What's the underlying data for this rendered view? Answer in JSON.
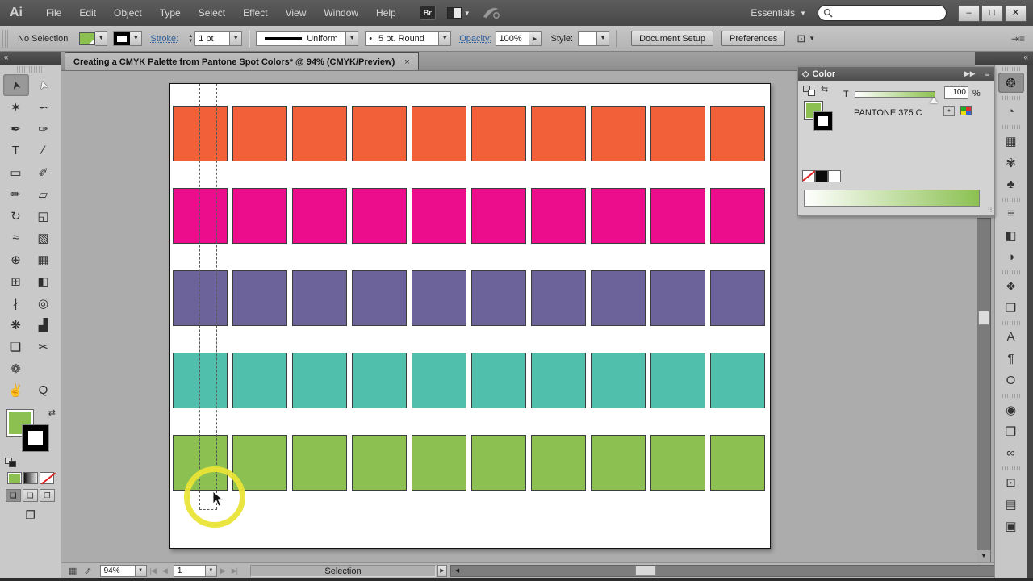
{
  "titlebar": {
    "logo": "Ai",
    "menus": [
      "File",
      "Edit",
      "Object",
      "Type",
      "Select",
      "Effect",
      "View",
      "Window",
      "Help"
    ],
    "bridge_label": "Br",
    "workspace": "Essentials",
    "search_placeholder": "",
    "window_buttons": {
      "minimize": "–",
      "maximize": "□",
      "close": "✕"
    }
  },
  "controlbar": {
    "selection_status": "No Selection",
    "stroke_label": "Stroke:",
    "stroke_value": "1 pt",
    "profile_value": "Uniform",
    "brush_bullet": "•",
    "brush_value": "5 pt. Round",
    "opacity_label": "Opacity:",
    "opacity_value": "100%",
    "style_label": "Style:",
    "document_setup_label": "Document Setup",
    "preferences_label": "Preferences"
  },
  "tab": {
    "title": "Creating a CMYK Palette from Pantone Spot Colors* @ 94% (CMYK/Preview)",
    "close": "×"
  },
  "toolbar": {
    "collapse": "«",
    "tools": [
      {
        "name": "selection",
        "glyph": "➤",
        "selected": true
      },
      {
        "name": "direct-selection",
        "glyph": "➤"
      },
      {
        "name": "magic-wand",
        "glyph": "✶"
      },
      {
        "name": "lasso",
        "glyph": "∽"
      },
      {
        "name": "pen",
        "glyph": "✒"
      },
      {
        "name": "blob-brush",
        "glyph": "✑"
      },
      {
        "name": "type",
        "glyph": "T"
      },
      {
        "name": "line-segment",
        "glyph": "∕"
      },
      {
        "name": "rectangle",
        "glyph": "▭"
      },
      {
        "name": "paintbrush",
        "glyph": "✐"
      },
      {
        "name": "pencil",
        "glyph": "✏"
      },
      {
        "name": "eraser",
        "glyph": "▱"
      },
      {
        "name": "rotate",
        "glyph": "↻"
      },
      {
        "name": "scale",
        "glyph": "◱"
      },
      {
        "name": "width",
        "glyph": "≈"
      },
      {
        "name": "free-transform",
        "glyph": "▧"
      },
      {
        "name": "shape-builder",
        "glyph": "⊕"
      },
      {
        "name": "perspective-grid",
        "glyph": "▦"
      },
      {
        "name": "mesh",
        "glyph": "⊞"
      },
      {
        "name": "gradient",
        "glyph": "◧"
      },
      {
        "name": "eyedropper",
        "glyph": "∤"
      },
      {
        "name": "blend",
        "glyph": "◎"
      },
      {
        "name": "symbol-sprayer",
        "glyph": "❋"
      },
      {
        "name": "column-graph",
        "glyph": "▟"
      },
      {
        "name": "artboard",
        "glyph": "❑"
      },
      {
        "name": "slice",
        "glyph": "✂"
      },
      {
        "name": "butterfly",
        "glyph": "❁"
      },
      {
        "name": "spacer",
        "glyph": ""
      },
      {
        "name": "hand",
        "glyph": "✌"
      },
      {
        "name": "zoom",
        "glyph": "Q"
      }
    ]
  },
  "canvas": {
    "columns": 10,
    "rows": [
      {
        "name": "orange",
        "color": "#F2603A"
      },
      {
        "name": "magenta",
        "color": "#EB0D8C"
      },
      {
        "name": "purple",
        "color": "#6B6399"
      },
      {
        "name": "teal",
        "color": "#50BFAC"
      },
      {
        "name": "green",
        "color": "#8CC152"
      }
    ]
  },
  "color_panel": {
    "title": "Color",
    "toggle": "◇",
    "collapse": "▶▶",
    "menu": "≡",
    "tint_label": "T",
    "tint_value": "100",
    "percent": "%",
    "swatch_name": "PANTONE 375 C",
    "ramp_from": "#FFFFFF",
    "ramp_to": "#8CC152"
  },
  "dock": {
    "collapse": "«",
    "items": [
      {
        "name": "color",
        "glyph": "❂",
        "selected": true,
        "grip": true
      },
      {
        "name": "color-guide",
        "glyph": "◔",
        "grip": true
      },
      {
        "name": "swatches",
        "glyph": "▦",
        "grip": true
      },
      {
        "name": "brushes",
        "glyph": "✾"
      },
      {
        "name": "symbols",
        "glyph": "♣"
      },
      {
        "name": "stroke",
        "glyph": "≡",
        "grip": true
      },
      {
        "name": "gradient",
        "glyph": "◧"
      },
      {
        "name": "transparency",
        "glyph": "◑"
      },
      {
        "name": "layers",
        "glyph": "❖",
        "grip": true
      },
      {
        "name": "artboards",
        "glyph": "❐"
      },
      {
        "name": "character",
        "glyph": "A",
        "grip": true
      },
      {
        "name": "paragraph",
        "glyph": "¶"
      },
      {
        "name": "opentype",
        "glyph": "O"
      },
      {
        "name": "appearance",
        "glyph": "◉",
        "grip": true
      },
      {
        "name": "graphic-styles",
        "glyph": "❒"
      },
      {
        "name": "kuler",
        "glyph": "∞"
      },
      {
        "name": "transform",
        "glyph": "⊡",
        "grip": true
      },
      {
        "name": "align",
        "glyph": "▤"
      },
      {
        "name": "pathfinder",
        "glyph": "▣"
      }
    ]
  },
  "statusbar": {
    "pattern_icon": "▦",
    "export_icon": "⇗",
    "zoom": "94%",
    "nav_first": "|◀",
    "nav_prev": "◀",
    "artboard": "1",
    "nav_next": "▶",
    "nav_last": "▶|",
    "status": "Selection"
  },
  "colors": {
    "pantone_375c": "#8CC152",
    "highlight_ring": "#E9E436"
  }
}
